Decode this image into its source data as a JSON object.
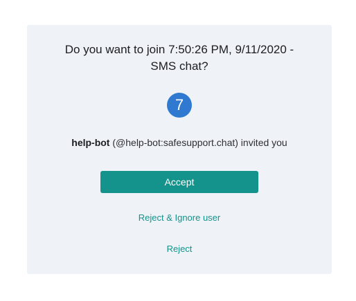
{
  "dialog": {
    "title_line1": "Do you want to join 7:50:26 PM, 9/11/2020 -",
    "title_line2": "SMS chat?",
    "avatar_initial": "7",
    "inviter_name": "help-bot",
    "inviter_detail": " (@help-bot:safesupport.chat) invited you",
    "accept_label": "Accept",
    "reject_ignore_label": "Reject & Ignore user",
    "reject_label": "Reject"
  },
  "colors": {
    "card_background": "#eff2f6",
    "accent": "#13938b",
    "avatar": "#2f7ad0"
  }
}
